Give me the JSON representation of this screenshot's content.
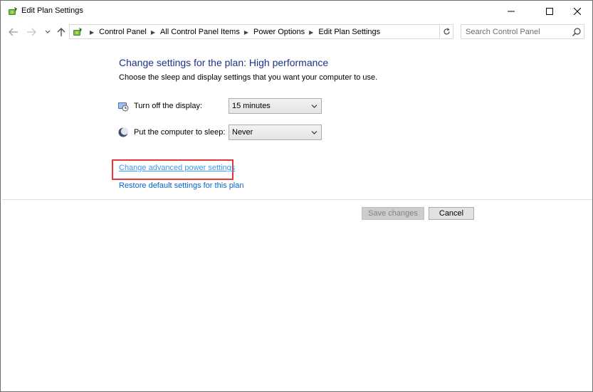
{
  "window": {
    "title": "Edit Plan Settings"
  },
  "navigation": {
    "breadcrumbs": [
      "Control Panel",
      "All Control Panel Items",
      "Power Options",
      "Edit Plan Settings"
    ],
    "search_placeholder": "Search Control Panel"
  },
  "main": {
    "heading": "Change settings for the plan: High performance",
    "description": "Choose the sleep and display settings that you want your computer to use.",
    "settings": [
      {
        "label": "Turn off the display:",
        "value": "15 minutes",
        "icon": "display-icon"
      },
      {
        "label": "Put the computer to sleep:",
        "value": "Never",
        "icon": "sleep-moon-icon"
      }
    ],
    "advanced_link": "Change advanced power settings",
    "restore_link": "Restore default settings for this plan"
  },
  "buttons": {
    "save": "Save changes",
    "cancel": "Cancel"
  },
  "colors": {
    "heading": "#1e3287",
    "link": "#0066cc",
    "highlight": "#e8343b"
  }
}
